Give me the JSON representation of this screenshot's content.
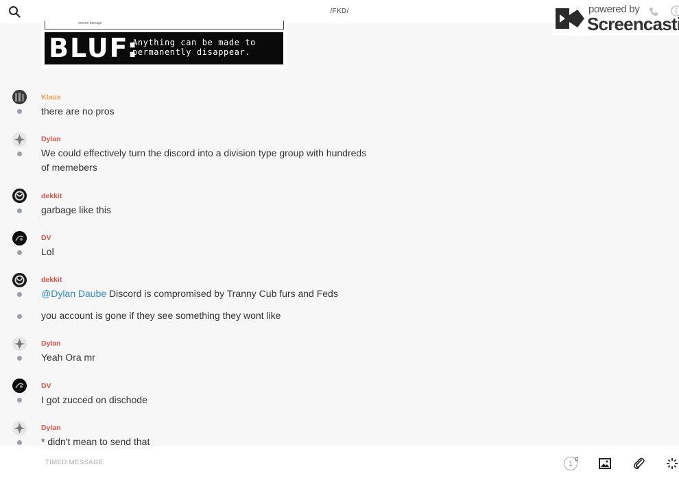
{
  "header": {
    "channel_title": "/FKD/",
    "watermark": {
      "powered_by": "powered by",
      "brand": "Screencastify"
    }
  },
  "image_card": {
    "strip_text": "ensure damage",
    "bluf_big": "BLUF:",
    "bluf_line1": "Anything can be made to",
    "bluf_line2": "permanently disappear."
  },
  "messages": [
    {
      "author": "Klaus",
      "lines": [
        "there are no pros"
      ]
    },
    {
      "author": "Dylan",
      "lines": [
        "We could effectively turn the discord into a division type group with hundreds",
        "of memebers"
      ]
    },
    {
      "author": "dekkit",
      "lines": [
        "garbage like this"
      ]
    },
    {
      "author": "DV",
      "lines": [
        "Lol"
      ]
    },
    {
      "author": "dekkit",
      "mention": "@Dylan Daube",
      "lines": [
        "Discord is compromised by Tranny Cub furs and Feds"
      ],
      "followup": "you account is gone if they see something they wont like"
    },
    {
      "author": "Dylan",
      "lines": [
        "Yeah Ora mr"
      ]
    },
    {
      "author": "DV",
      "lines": [
        "I got zucced on dischode"
      ]
    },
    {
      "author": "Dylan",
      "lines": [
        "* didn't mean to send that"
      ]
    }
  ],
  "composer": {
    "placeholder": "TIMED MESSAGE",
    "timer_value": "1",
    "timer_unit": "d"
  },
  "colors": {
    "author_default": "#e0524a",
    "author_klaus": "#f2a04a",
    "mention": "#2a8ad8",
    "dot": "#9aa0a8"
  },
  "icons": [
    "search-icon",
    "screencastify-logo",
    "phone-icon",
    "info-icon",
    "image-icon",
    "paperclip-icon",
    "sparkle-icon"
  ]
}
